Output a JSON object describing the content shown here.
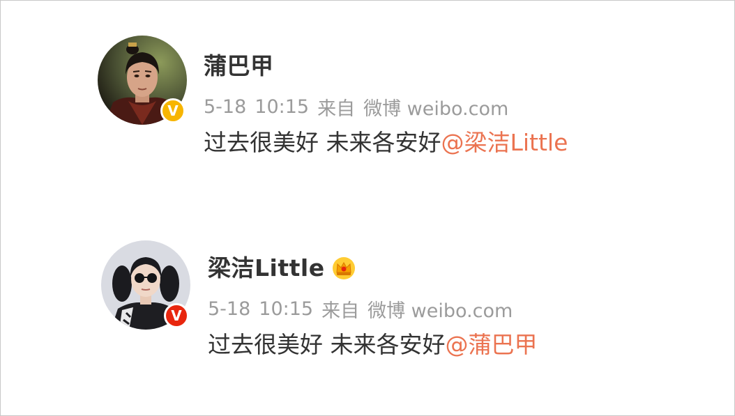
{
  "posts": [
    {
      "username": "蒲巴甲",
      "verified_badge": "V",
      "badge_color": "#f7b500",
      "avatar_icon": "user-avatar-male-icon",
      "date": "5-18",
      "time": "10:15",
      "source_prefix": "来自",
      "source": "微博 weibo.com",
      "text": "过去很美好 未来各安好",
      "mention": "@梁洁Little"
    },
    {
      "username": "梁洁Little",
      "verified_badge": "V",
      "badge_color": "#e8260e",
      "avatar_icon": "user-avatar-female-icon",
      "member_icon": "crown-icon",
      "date": "5-18",
      "time": "10:15",
      "source_prefix": "来自",
      "source": "微博 weibo.com",
      "text": "过去很美好 未来各安好",
      "mention": "@蒲巴甲"
    }
  ],
  "colors": {
    "username": "#333333",
    "meta": "#9b9b9b",
    "mention": "#eb7350",
    "text": "#333333"
  }
}
